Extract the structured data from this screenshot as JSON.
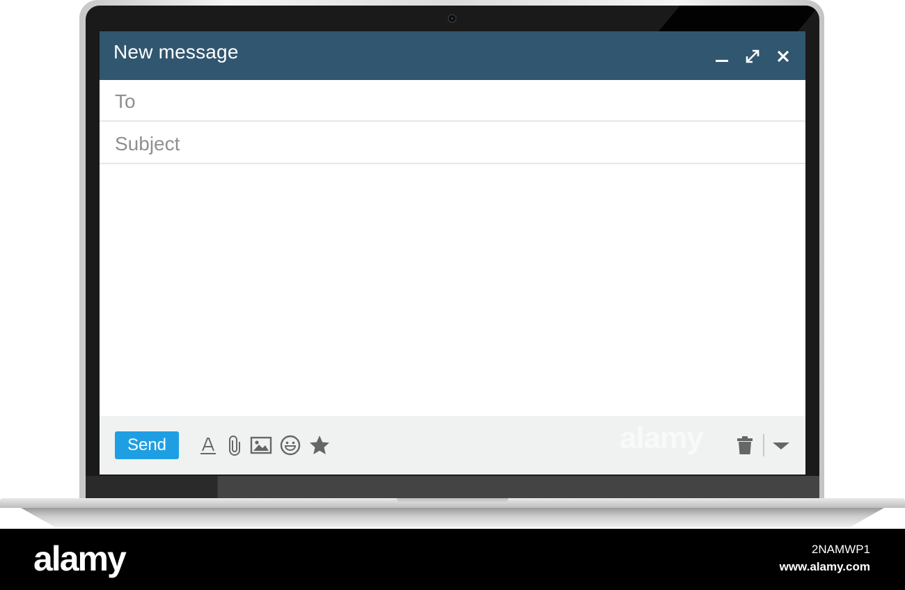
{
  "window": {
    "title": "New message",
    "controls": {
      "minimize_icon": "minimize-icon",
      "expand_icon": "expand-icon",
      "close_icon": "close-icon"
    }
  },
  "compose": {
    "to_placeholder": "To",
    "to_value": "",
    "subject_placeholder": "Subject",
    "subject_value": "",
    "body_value": ""
  },
  "toolbar": {
    "send_label": "Send",
    "icons": [
      "text-format-icon",
      "attachment-icon",
      "image-icon",
      "emoji-icon",
      "star-icon",
      "trash-icon",
      "chevron-down-icon"
    ]
  },
  "watermark": {
    "text": "alamy"
  },
  "banner": {
    "brand": "alamy",
    "image_id": "2NAMWP1",
    "url": "www.alamy.com"
  },
  "colors": {
    "header": "#31566f",
    "send_button": "#1f9fe3",
    "toolbar_bg": "#f0f2f1",
    "icon": "#666666"
  }
}
